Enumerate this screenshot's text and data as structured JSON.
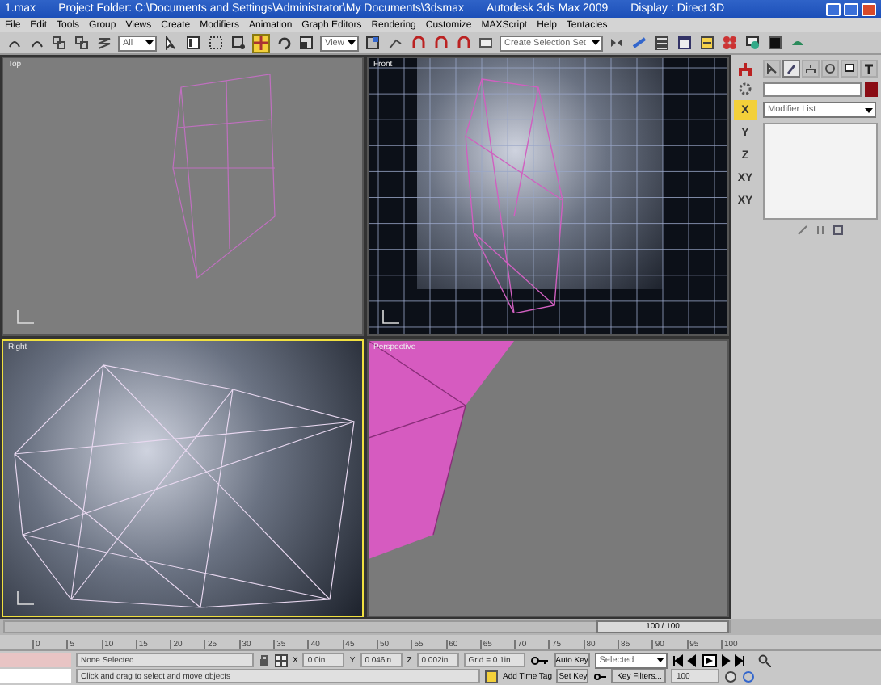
{
  "window": {
    "file": "1.max",
    "title": "Project Folder: C:\\Documents and Settings\\Administrator\\My Documents\\3dsmax",
    "app": "Autodesk 3ds Max 2009",
    "display": "Display : Direct 3D"
  },
  "menu": [
    "File",
    "Edit",
    "Tools",
    "Group",
    "Views",
    "Create",
    "Modifiers",
    "Animation",
    "Graph Editors",
    "Rendering",
    "Customize",
    "MAXScript",
    "Help",
    "Tentacles"
  ],
  "toolbar": {
    "selection_filter": "All",
    "reference_coordinate": "View",
    "selection_set": "Create Selection Set",
    "tools": [
      {
        "kind": "undo",
        "selected": false
      },
      {
        "kind": "redo",
        "selected": false
      },
      {
        "kind": "link",
        "selected": false
      },
      {
        "kind": "unlink",
        "selected": false
      },
      {
        "kind": "bind",
        "selected": false
      },
      {
        "kind": "select",
        "selected": false
      },
      {
        "kind": "select_name",
        "selected": false
      },
      {
        "kind": "region",
        "selected": false
      },
      {
        "kind": "window",
        "selected": false
      },
      {
        "kind": "move",
        "selected": true
      },
      {
        "kind": "rotate",
        "selected": false
      },
      {
        "kind": "scale",
        "selected": false
      },
      {
        "kind": "pivot",
        "selected": false
      },
      {
        "kind": "snap",
        "selected": false
      },
      {
        "kind": "angle",
        "selected": false
      },
      {
        "kind": "percent",
        "selected": false
      },
      {
        "kind": "spinner",
        "selected": false
      },
      {
        "kind": "edit_set",
        "selected": false
      },
      {
        "kind": "mirror",
        "selected": false
      },
      {
        "kind": "align",
        "selected": false
      },
      {
        "kind": "layers",
        "selected": false
      },
      {
        "kind": "curve",
        "selected": false
      },
      {
        "kind": "schematic",
        "selected": false
      },
      {
        "kind": "material",
        "selected": false
      },
      {
        "kind": "render_setup",
        "selected": false
      },
      {
        "kind": "render_frame",
        "selected": false
      },
      {
        "kind": "teapot",
        "selected": false
      }
    ]
  },
  "viewports": [
    {
      "label": "Top",
      "kind": "top",
      "selected": false
    },
    {
      "label": "Front",
      "kind": "front",
      "selected": false
    },
    {
      "label": "Right",
      "kind": "right",
      "selected": true
    },
    {
      "label": "Perspective",
      "kind": "perspective",
      "selected": false
    }
  ],
  "command_panel": {
    "tabs": [
      {
        "kind": "create",
        "selected": false
      },
      {
        "kind": "modify",
        "selected": true
      },
      {
        "kind": "hierarchy",
        "selected": false
      },
      {
        "kind": "motion",
        "selected": false
      },
      {
        "kind": "display",
        "selected": false
      },
      {
        "kind": "utilities",
        "selected": false
      }
    ],
    "modifier_list": "Modifier List",
    "axes": [
      {
        "label": "X",
        "selected": true
      },
      {
        "label": "Y",
        "selected": false
      },
      {
        "label": "Z",
        "selected": false
      },
      {
        "label": "XY",
        "selected": false
      },
      {
        "label": "XY",
        "selected": false
      }
    ]
  },
  "time_slider": {
    "reading": "100 / 100",
    "level": 1
  },
  "ruler": [
    "0",
    "5",
    "10",
    "15",
    "20",
    "25",
    "30",
    "35",
    "40",
    "45",
    "50",
    "55",
    "60",
    "65",
    "70",
    "75",
    "80",
    "85",
    "90",
    "95",
    "100"
  ],
  "status": {
    "selection": "None Selected",
    "x_label": "X",
    "x": "0.0in",
    "y_label": "Y",
    "y": "0.046in",
    "z_label": "Z",
    "z": "0.002in",
    "grid": "Grid = 0.1in",
    "auto_key": "Auto Key",
    "key_mode": "Selected",
    "set_key": "Set Key",
    "key_filters": "Key Filters...",
    "prompt": "Click and drag to select and move objects",
    "time_tag": "Add Time Tag",
    "frame": "100"
  }
}
